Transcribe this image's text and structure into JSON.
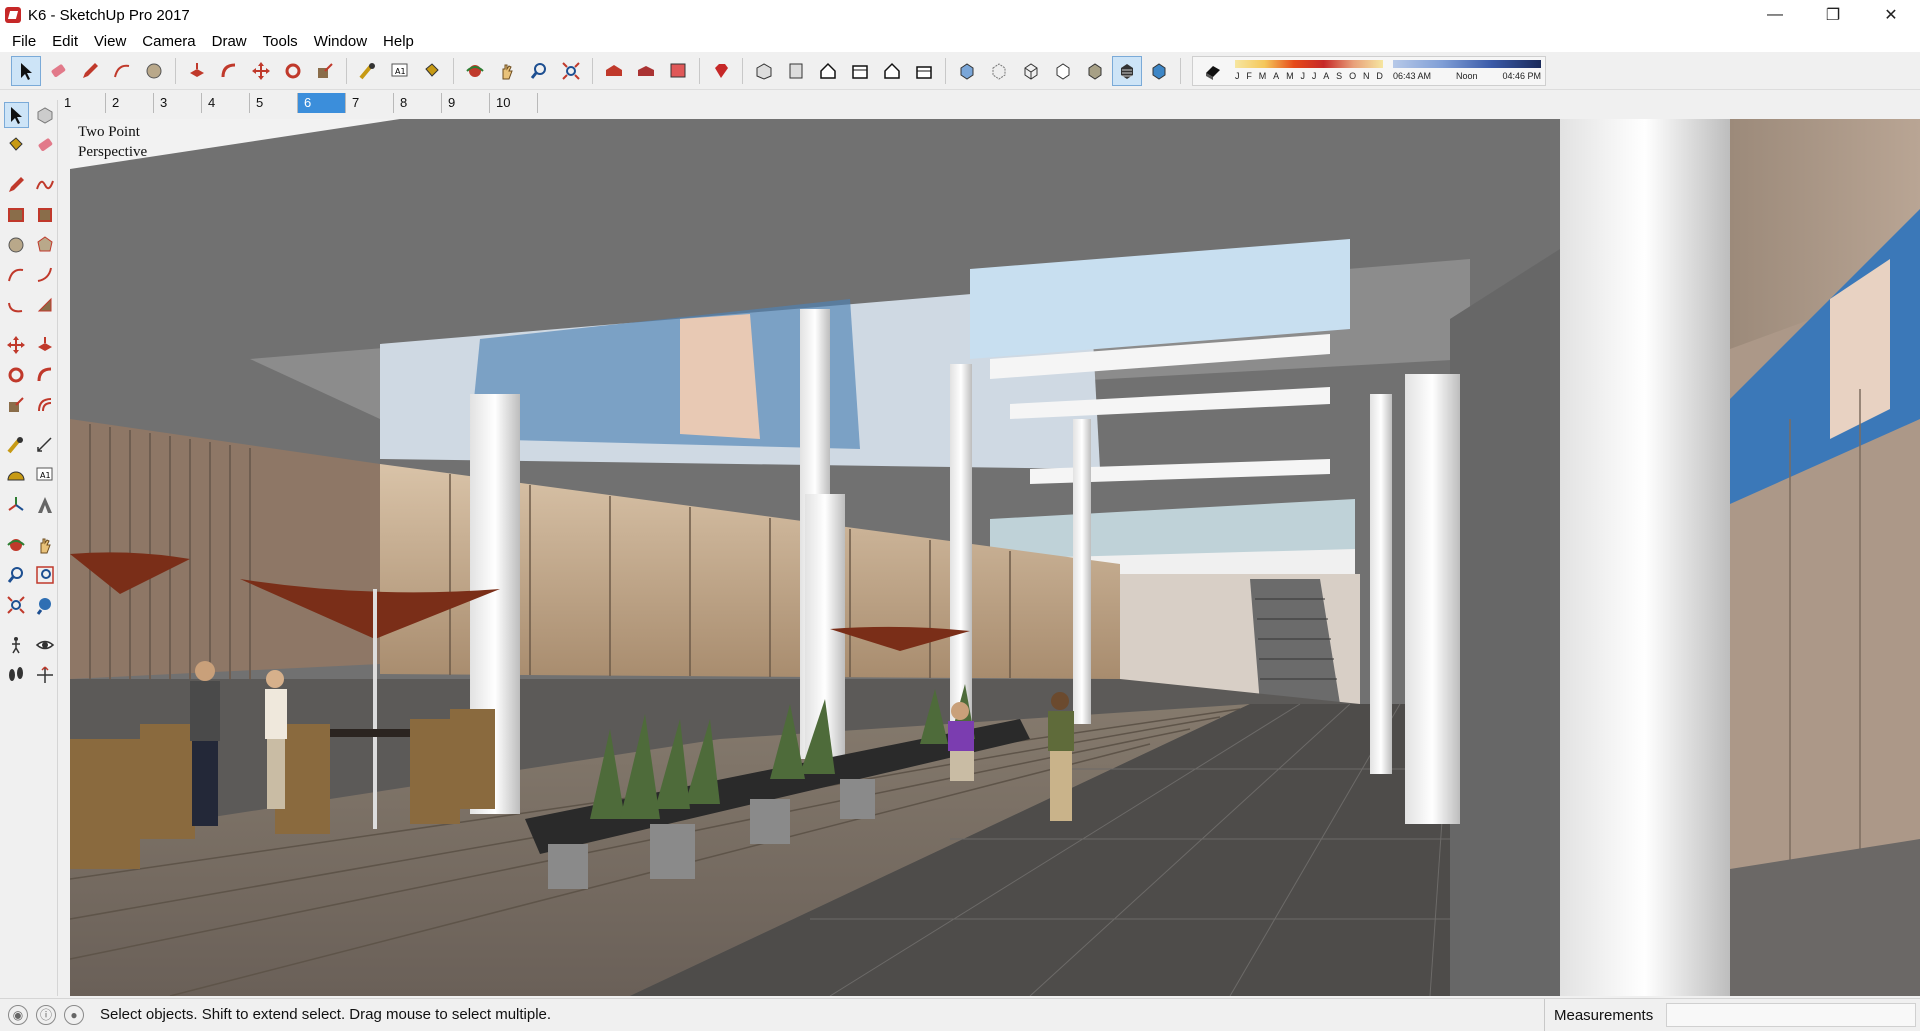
{
  "window": {
    "title": "K6 - SketchUp Pro 2017",
    "controls": {
      "minimize": "—",
      "maximize": "❐",
      "close": "✕"
    }
  },
  "menu": [
    "File",
    "Edit",
    "View",
    "Camera",
    "Draw",
    "Tools",
    "Window",
    "Help"
  ],
  "toolbar": {
    "icons": [
      "select-icon",
      "eraser-icon",
      "pencil-icon",
      "rectangle-icon",
      "circle-icon",
      "push-pull-icon",
      "follow-me-icon",
      "move-icon",
      "rotate-icon",
      "scale-icon",
      "tape-measure-icon",
      "text-icon",
      "paint-bucket-icon",
      "orbit-icon",
      "pan-icon",
      "zoom-icon",
      "zoom-extents-icon",
      "warehouse-icon",
      "extension-warehouse-icon",
      "layout-icon",
      "ruby-icon",
      "iso-view-icon",
      "top-view-icon",
      "front-view-icon",
      "right-view-icon",
      "back-view-icon",
      "left-view-icon",
      "xray-icon",
      "back-edges-icon",
      "wireframe-icon",
      "hidden-line-icon",
      "shaded-icon",
      "shaded-textures-icon",
      "monochrome-icon",
      "shadows-icon"
    ],
    "shadow_months": [
      "J",
      "F",
      "M",
      "A",
      "M",
      "J",
      "J",
      "A",
      "S",
      "O",
      "N",
      "D"
    ],
    "shadow_times": [
      "06:43 AM",
      "Noon",
      "04:46 PM"
    ]
  },
  "scenes": [
    "1",
    "2",
    "3",
    "4",
    "5",
    "6",
    "7",
    "8",
    "9",
    "10"
  ],
  "active_scene": "6",
  "viewport": {
    "perspective_line1": "Two Point",
    "perspective_line2": "Perspective"
  },
  "status": {
    "message": "Select objects. Shift to extend select. Drag mouse to select multiple.",
    "measurements_label": "Measurements",
    "measurements_value": ""
  },
  "colors": {
    "accent": "#3b8edb",
    "sky": "#bcd8ec",
    "floor": "#7b7065",
    "ceiling": "#6d6d6d"
  }
}
